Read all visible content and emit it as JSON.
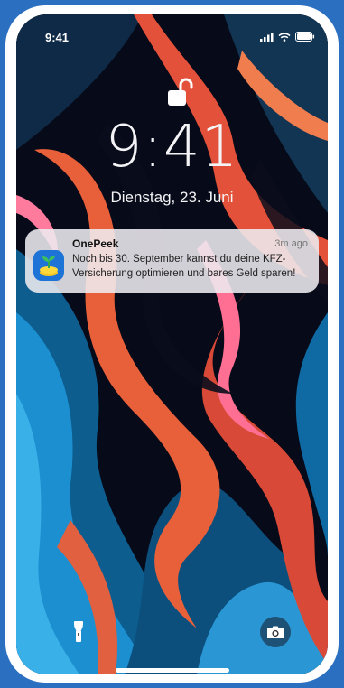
{
  "status_bar": {
    "time": "9:41"
  },
  "lock_screen": {
    "time": "9:41",
    "date": "Dienstag, 23. Juni"
  },
  "notification": {
    "app_name": "OnePeek",
    "timestamp": "3m ago",
    "message": "Noch bis 30. September kannst du deine KFZ-Versicherung optimieren und bares Geld sparen!",
    "icon": "sprout-coin-icon"
  },
  "icons": {
    "lock": "unlocked-padlock-icon",
    "signal": "cellular-signal-icon",
    "wifi": "wifi-icon",
    "battery": "battery-icon",
    "flashlight": "flashlight-icon",
    "camera": "camera-icon"
  },
  "colors": {
    "background": "#2a6fc0",
    "frame": "#ffffff",
    "notification_icon_bg": "#1e73d6"
  }
}
